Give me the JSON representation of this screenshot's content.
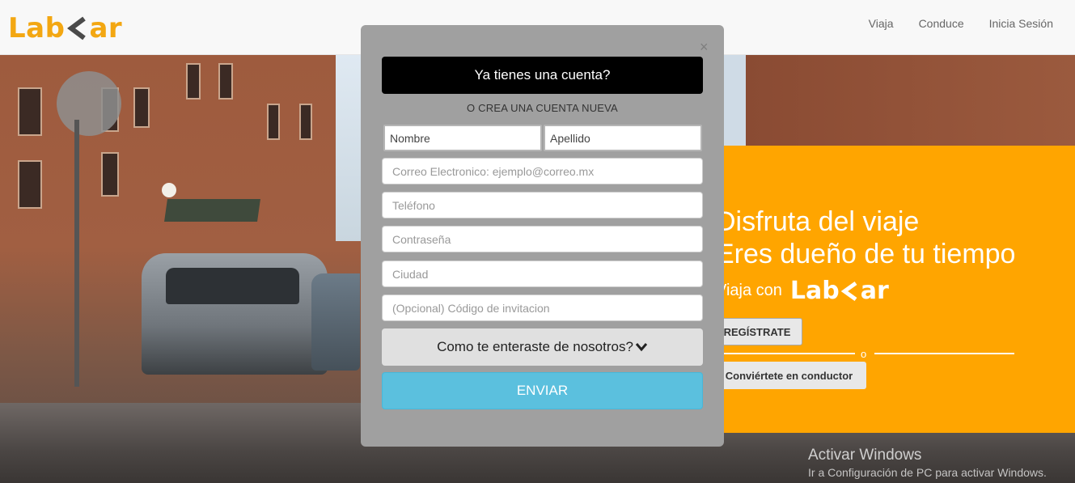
{
  "header": {
    "logo_left": "Lab",
    "logo_right": "ar",
    "nav": [
      "Viaja",
      "Conduce",
      "Inicia Sesión"
    ]
  },
  "promo": {
    "line1": "Disfruta del viaje",
    "line2": "Eres dueño de tu tiempo",
    "line3": "Viaja con",
    "logo_left": "Lab",
    "logo_right": "ar",
    "register_label": "REGÍSTRATE",
    "or_label": "o",
    "driver_label": "Conviértete en conductor",
    "color": "#ffa500"
  },
  "modal": {
    "close_glyph": "×",
    "login_label": "Ya tienes una cuenta?",
    "or_create": "O CREA UNA CUENTA NUEVA",
    "first_name": "Nombre",
    "last_name": "Apellido",
    "email_placeholder": "Correo Electronico: ejemplo@correo.mx",
    "phone_placeholder": "Teléfono",
    "password_placeholder": "Contraseña",
    "city_placeholder": "Ciudad",
    "invite_placeholder": "(Opcional) Código de invitacion",
    "how_label": "Como te enteraste de nosotros?",
    "submit_label": "ENVIAR"
  },
  "watermark": {
    "title": "Activar Windows",
    "subtitle": "Ir a Configuración de PC para activar Windows."
  },
  "colors": {
    "brand": "#f3a712",
    "submit": "#5bc0de",
    "login": "#000000"
  },
  "icons": [
    "chevron-left-icon",
    "close-icon",
    "chevron-down-icon"
  ]
}
